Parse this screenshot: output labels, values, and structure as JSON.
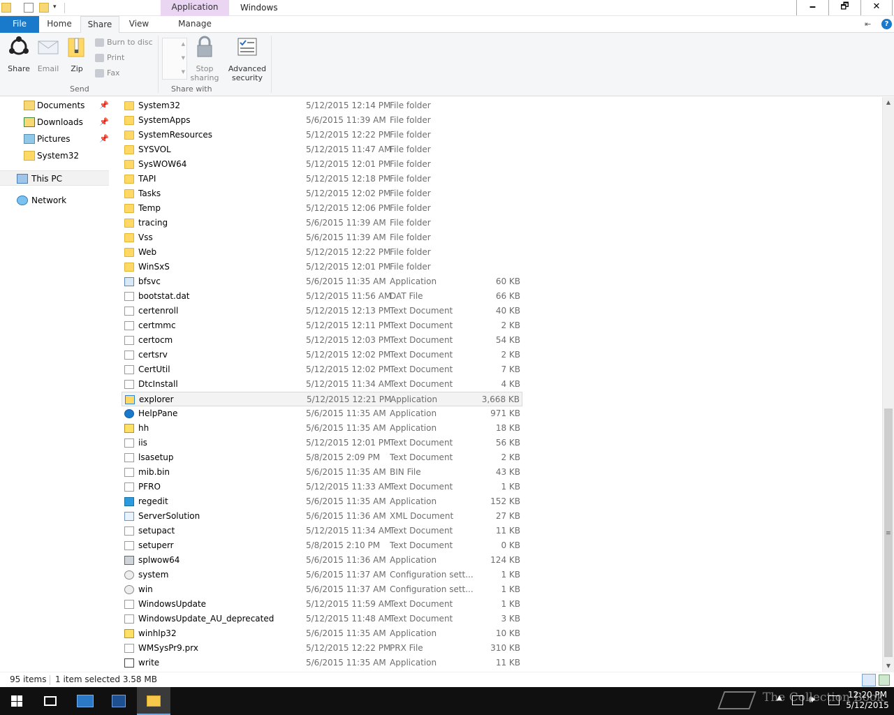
{
  "window": {
    "context_tab": "Application Tools",
    "title": "Windows",
    "buttons": {
      "minimize": "🗕",
      "maximize": "🗗",
      "close": "✕"
    },
    "quick_access_dropdown": "▾"
  },
  "ribbon_tabs": {
    "file": "File",
    "home": "Home",
    "share": "Share",
    "view": "View",
    "manage": "Manage",
    "collapse": "⇤",
    "help": "?"
  },
  "ribbon": {
    "share_label": "Share",
    "email_label": "Email",
    "zip_label": "Zip",
    "burn_label": "Burn to disc",
    "print_label": "Print",
    "fax_label": "Fax",
    "send_group": "Send",
    "stop_sharing_label_1": "Stop",
    "stop_sharing_label_2": "sharing",
    "advanced_security_1": "Advanced",
    "advanced_security_2": "security",
    "share_with_group": "Share with"
  },
  "nav": {
    "items": [
      {
        "label": "Documents",
        "icon": "documents-icon",
        "pinned": true
      },
      {
        "label": "Downloads",
        "icon": "downloads-icon",
        "pinned": true
      },
      {
        "label": "Pictures",
        "icon": "pictures-icon",
        "pinned": true
      },
      {
        "label": "System32",
        "icon": "folder-icon",
        "pinned": false
      }
    ],
    "this_pc": "This PC",
    "network": "Network",
    "pin_glyph": "📌"
  },
  "files": [
    {
      "name": "System32",
      "date": "5/12/2015 12:14 PM",
      "type": "File folder",
      "size": "",
      "icon": "folder"
    },
    {
      "name": "SystemApps",
      "date": "5/6/2015 11:39 AM",
      "type": "File folder",
      "size": "",
      "icon": "folder"
    },
    {
      "name": "SystemResources",
      "date": "5/12/2015 12:22 PM",
      "type": "File folder",
      "size": "",
      "icon": "folder"
    },
    {
      "name": "SYSVOL",
      "date": "5/12/2015 11:47 AM",
      "type": "File folder",
      "size": "",
      "icon": "folder"
    },
    {
      "name": "SysWOW64",
      "date": "5/12/2015 12:01 PM",
      "type": "File folder",
      "size": "",
      "icon": "folder"
    },
    {
      "name": "TAPI",
      "date": "5/12/2015 12:18 PM",
      "type": "File folder",
      "size": "",
      "icon": "folder"
    },
    {
      "name": "Tasks",
      "date": "5/12/2015 12:02 PM",
      "type": "File folder",
      "size": "",
      "icon": "folder"
    },
    {
      "name": "Temp",
      "date": "5/12/2015 12:06 PM",
      "type": "File folder",
      "size": "",
      "icon": "folder"
    },
    {
      "name": "tracing",
      "date": "5/6/2015 11:39 AM",
      "type": "File folder",
      "size": "",
      "icon": "folder"
    },
    {
      "name": "Vss",
      "date": "5/6/2015 11:39 AM",
      "type": "File folder",
      "size": "",
      "icon": "folder"
    },
    {
      "name": "Web",
      "date": "5/12/2015 12:22 PM",
      "type": "File folder",
      "size": "",
      "icon": "folder"
    },
    {
      "name": "WinSxS",
      "date": "5/12/2015 12:01 PM",
      "type": "File folder",
      "size": "",
      "icon": "folder"
    },
    {
      "name": "bfsvc",
      "date": "5/6/2015 11:35 AM",
      "type": "Application",
      "size": "60 KB",
      "icon": "app"
    },
    {
      "name": "bootstat.dat",
      "date": "5/12/2015 11:56 AM",
      "type": "DAT File",
      "size": "66 KB",
      "icon": "doc"
    },
    {
      "name": "certenroll",
      "date": "5/12/2015 12:13 PM",
      "type": "Text Document",
      "size": "40 KB",
      "icon": "doc"
    },
    {
      "name": "certmmc",
      "date": "5/12/2015 12:11 PM",
      "type": "Text Document",
      "size": "2 KB",
      "icon": "doc"
    },
    {
      "name": "certocm",
      "date": "5/12/2015 12:03 PM",
      "type": "Text Document",
      "size": "54 KB",
      "icon": "doc"
    },
    {
      "name": "certsrv",
      "date": "5/12/2015 12:02 PM",
      "type": "Text Document",
      "size": "2 KB",
      "icon": "doc"
    },
    {
      "name": "CertUtil",
      "date": "5/12/2015 12:02 PM",
      "type": "Text Document",
      "size": "7 KB",
      "icon": "doc"
    },
    {
      "name": "DtcInstall",
      "date": "5/12/2015 11:34 AM",
      "type": "Text Document",
      "size": "4 KB",
      "icon": "doc"
    },
    {
      "name": "explorer",
      "date": "5/12/2015 12:21 PM",
      "type": "Application",
      "size": "3,668 KB",
      "icon": "explorer",
      "selected": true
    },
    {
      "name": "HelpPane",
      "date": "5/6/2015 11:35 AM",
      "type": "Application",
      "size": "971 KB",
      "icon": "help"
    },
    {
      "name": "hh",
      "date": "5/6/2015 11:35 AM",
      "type": "Application",
      "size": "18 KB",
      "icon": "hhq"
    },
    {
      "name": "iis",
      "date": "5/12/2015 12:01 PM",
      "type": "Text Document",
      "size": "56 KB",
      "icon": "doc"
    },
    {
      "name": "lsasetup",
      "date": "5/8/2015 2:09 PM",
      "type": "Text Document",
      "size": "2 KB",
      "icon": "doc"
    },
    {
      "name": "mib.bin",
      "date": "5/6/2015 11:35 AM",
      "type": "BIN File",
      "size": "43 KB",
      "icon": "doc"
    },
    {
      "name": "PFRO",
      "date": "5/12/2015 11:33 AM",
      "type": "Text Document",
      "size": "1 KB",
      "icon": "doc"
    },
    {
      "name": "regedit",
      "date": "5/6/2015 11:35 AM",
      "type": "Application",
      "size": "152 KB",
      "icon": "regedit"
    },
    {
      "name": "ServerSolution",
      "date": "5/6/2015 11:36 AM",
      "type": "XML Document",
      "size": "27 KB",
      "icon": "xml"
    },
    {
      "name": "setupact",
      "date": "5/12/2015 11:34 AM",
      "type": "Text Document",
      "size": "11 KB",
      "icon": "doc"
    },
    {
      "name": "setuperr",
      "date": "5/8/2015 2:10 PM",
      "type": "Text Document",
      "size": "0 KB",
      "icon": "doc"
    },
    {
      "name": "splwow64",
      "date": "5/6/2015 11:36 AM",
      "type": "Application",
      "size": "124 KB",
      "icon": "print"
    },
    {
      "name": "system",
      "date": "5/6/2015 11:37 AM",
      "type": "Configuration sett...",
      "size": "1 KB",
      "icon": "cfg"
    },
    {
      "name": "win",
      "date": "5/6/2015 11:37 AM",
      "type": "Configuration sett...",
      "size": "1 KB",
      "icon": "cfg"
    },
    {
      "name": "WindowsUpdate",
      "date": "5/12/2015 11:59 AM",
      "type": "Text Document",
      "size": "1 KB",
      "icon": "doc"
    },
    {
      "name": "WindowsUpdate_AU_deprecated",
      "date": "5/12/2015 11:48 AM",
      "type": "Text Document",
      "size": "3 KB",
      "icon": "doc"
    },
    {
      "name": "winhlp32",
      "date": "5/6/2015 11:35 AM",
      "type": "Application",
      "size": "10 KB",
      "icon": "hhq"
    },
    {
      "name": "WMSysPr9.prx",
      "date": "5/12/2015 12:22 PM",
      "type": "PRX File",
      "size": "310 KB",
      "icon": "doc"
    },
    {
      "name": "write",
      "date": "5/6/2015 11:35 AM",
      "type": "Application",
      "size": "11 KB",
      "icon": "write"
    }
  ],
  "status": {
    "item_count": "95 items",
    "selection": "1 item selected  3.58 MB"
  },
  "scrollbar": {
    "up": "▲",
    "down": "▼",
    "grip": "≡"
  },
  "taskbar": {
    "time": "12:20 PM",
    "date": "5/12/2015",
    "watermark": "The Collection Book",
    "tray_chevron": "▲",
    "volume": "🕪"
  },
  "colors": {
    "accent": "#1979ca",
    "context_tab": "#ead6f2",
    "folder": "#ffd866",
    "taskbar": "#101010"
  }
}
